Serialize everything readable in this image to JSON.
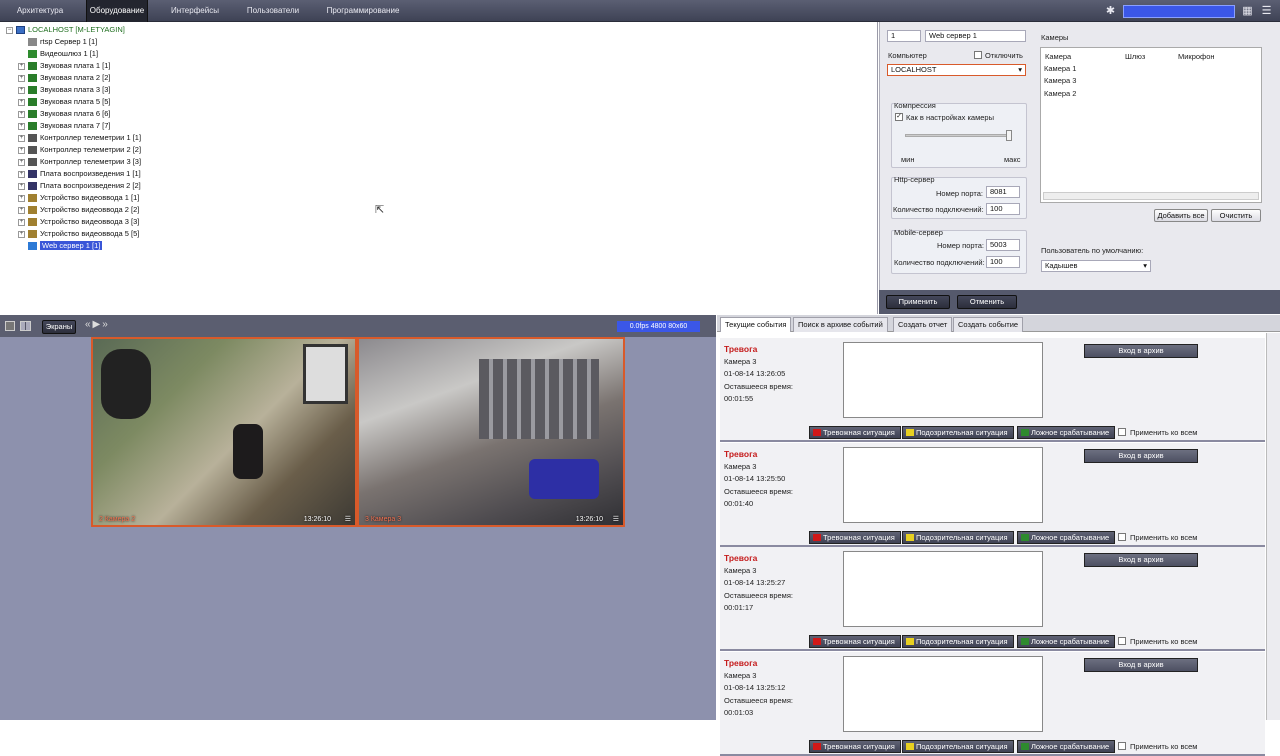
{
  "menu": {
    "items": [
      "Архитектура",
      "Оборудование",
      "Интерфейсы",
      "Пользователи",
      "Программирование"
    ],
    "active": 1
  },
  "tree": {
    "root": "LOCALHOST [M-LETYAGIN]",
    "items": [
      "rtsp Сервер 1 [1]",
      "Видеошлюз 1 [1]",
      "Звуковая плата 1 [1]",
      "Звуковая плата 2 [2]",
      "Звуковая плата 3 [3]",
      "Звуковая плата 5 [5]",
      "Звуковая плата 6 [6]",
      "Звуковая плата 7 [7]",
      "Контроллер телеметрии 1 [1]",
      "Контроллер телеметрии 2 [2]",
      "Контроллер телеметрии 3 [3]",
      "Плата воспроизведения 1 [1]",
      "Плата воспроизведения 2 [2]",
      "Устройство видеоввода 1 [1]",
      "Устройство видеоввода 2 [2]",
      "Устройство видеоввода 3 [3]",
      "Устройство видеоввода 5 [5]",
      "Web сервер 1 [1]"
    ]
  },
  "settings": {
    "id": "1",
    "name": "Web сервер 1",
    "computer_label": "Компьютер",
    "disable_label": "Отключить",
    "computer_value": "LOCALHOST",
    "compression_label": "Компрессия",
    "as_camera_label": "Как в настройках камеры",
    "min_label": "мин",
    "max_label": "макс",
    "http_label": "Http-сервер",
    "port_label": "Номер порта:",
    "http_port": "8081",
    "conn_label": "Количество подключений:",
    "http_conn": "100",
    "mobile_label": "Mobile-сервер",
    "mobile_port": "5003",
    "mobile_conn": "100",
    "cameras_label": "Камеры",
    "cam_cols": [
      "Камера",
      "Шлюз",
      "Микрофон"
    ],
    "cameras": [
      "Камера 1",
      "Камера 3",
      "Камера 2"
    ],
    "add_all": "Добавить все",
    "clear": "Очистить",
    "default_user_label": "Пользователь по умолчанию:",
    "default_user": "Кадышев",
    "apply": "Применить",
    "cancel": "Отменить"
  },
  "video": {
    "screens_label": "Экраны",
    "fps_text": "0.0fps  4800 80x60",
    "cam1_label": "2   Камера 2",
    "cam1_time": "13:26:10",
    "cam2_label": "3   Камера 3",
    "cam2_time": "13:26:10"
  },
  "events": {
    "tabs": [
      "Текущие события",
      "Поиск в архиве событий",
      "Создать отчет",
      "Создать событие"
    ],
    "archive_btn": "Вход в архив",
    "alarm_btn": "Тревожная ситуация",
    "suspicious_btn": "Подозрительная ситуация",
    "false_btn": "Ложное срабатывание",
    "apply_all": "Применить ко всем",
    "remaining_label": "Оставшееся время:",
    "list": [
      {
        "title": "Тревога",
        "camera": "Камера 3",
        "datetime": "01-08-14 13:26:05",
        "remaining": "00:01:55"
      },
      {
        "title": "Тревога",
        "camera": "Камера 3",
        "datetime": "01-08-14 13:25:50",
        "remaining": "00:01:40"
      },
      {
        "title": "Тревога",
        "camera": "Камера 3",
        "datetime": "01-08-14 13:25:27",
        "remaining": "00:01:17"
      },
      {
        "title": "Тревога",
        "camera": "Камера 3",
        "datetime": "01-08-14 13:25:12",
        "remaining": "00:01:03"
      }
    ]
  },
  "colors": {
    "accent": "#3a56d8",
    "alarm": "#c51c1c",
    "topbar": "#4b4f62",
    "video_bg": "#8d91ad"
  }
}
